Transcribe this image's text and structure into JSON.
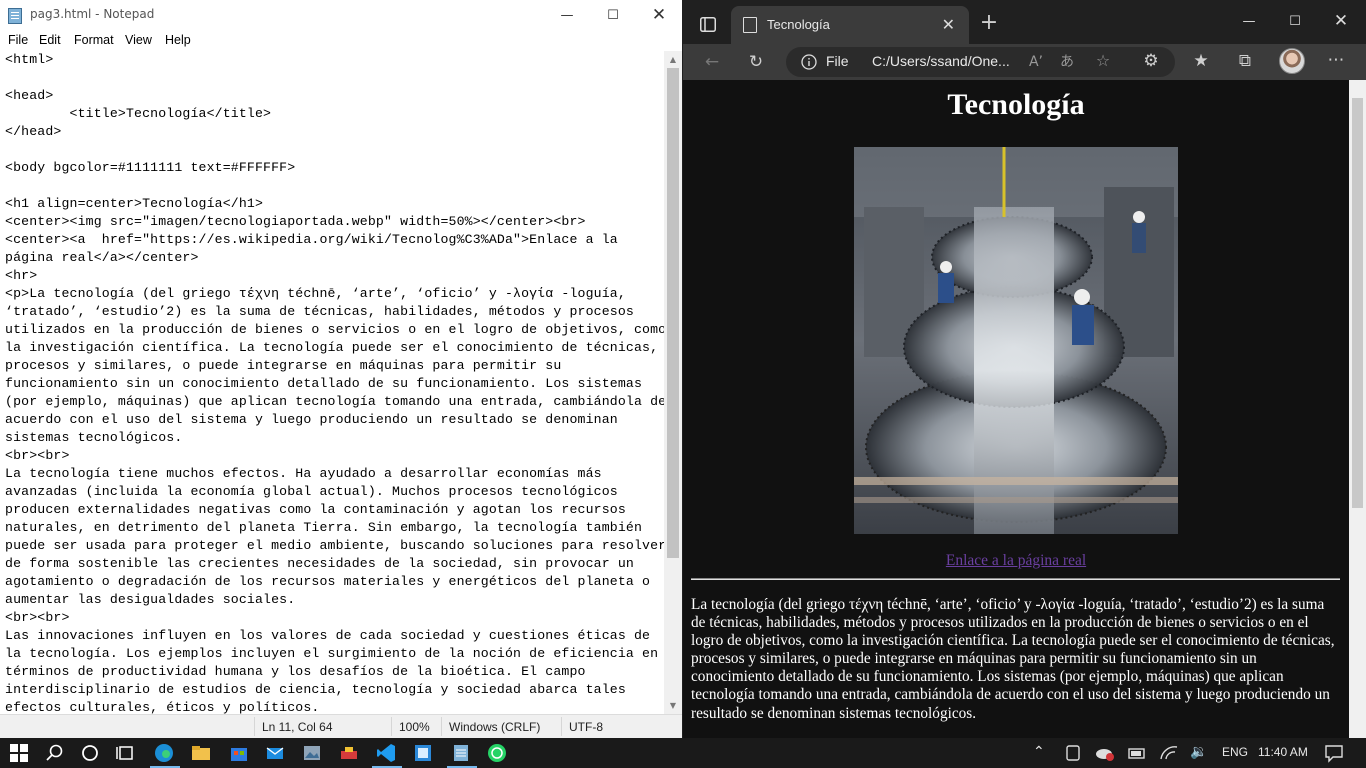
{
  "notepad": {
    "title": "pag3.html - Notepad",
    "menu": [
      "File",
      "Edit",
      "Format",
      "View",
      "Help"
    ],
    "content": "<html>\n\n<head>\n        <title>Tecnología</title>\n</head>\n\n<body bgcolor=#1111111 text=#FFFFFF>\n\n<h1 align=center>Tecnología</h1>\n<center><img src=\"imagen/tecnologiaportada.webp\" width=50%></center><br>\n<center><a  href=\"https://es.wikipedia.org/wiki/Tecnolog%C3%ADa\">Enlace a la\npágina real</a></center>\n<hr>\n<p>La tecnología (del griego τέχνη téchnē, ‘arte’, ‘oficio’ y -λογία -loguía,\n‘tratado’, ‘estudio’2) es la suma de técnicas, habilidades, métodos y procesos\nutilizados en la producción de bienes o servicios o en el logro de objetivos, como\nla investigación científica. La tecnología puede ser el conocimiento de técnicas,\nprocesos y similares, o puede integrarse en máquinas para permitir su\nfuncionamiento sin un conocimiento detallado de su funcionamiento. Los sistemas\n(por ejemplo, máquinas) que aplican tecnología tomando una entrada, cambiándola de\nacuerdo con el uso del sistema y luego produciendo un resultado se denominan\nsistemas tecnológicos.\n<br><br>\nLa tecnología tiene muchos efectos. Ha ayudado a desarrollar economías más\navanzadas (incluida la economía global actual). Muchos procesos tecnológicos\nproducen externalidades negativas como la contaminación y agotan los recursos\nnaturales, en detrimento del planeta Tierra. Sin embargo, la tecnología también\npuede ser usada para proteger el medio ambiente, buscando soluciones para resolver\nde forma sostenible las crecientes necesidades de la sociedad, sin provocar un\nagotamiento o degradación de los recursos materiales y energéticos del planeta o\naumentar las desigualdades sociales.\n<br><br>\nLas innovaciones influyen en los valores de cada sociedad y cuestiones éticas de\nla tecnología. Los ejemplos incluyen el surgimiento de la noción de eficiencia en\ntérminos de productividad humana y los desafíos de la bioética. El campo\ninterdisciplinario de estudios de ciencia, tecnología y sociedad abarca tales\nefectos culturales, éticos y políticos.",
    "status": {
      "position": "Ln 11, Col 64",
      "zoom": "100%",
      "line_ending": "Windows (CRLF)",
      "encoding": "UTF-8"
    }
  },
  "browser": {
    "tab_title": "Tecnología",
    "address_scheme": "File",
    "address": "C:/Users/ssand/One...",
    "page": {
      "heading": "Tecnología",
      "link_text": "Enlace a la página real",
      "paragraph": "La tecnología (del griego τέχνη téchnē, ‘arte’, ‘oficio’ y -λογία -loguía, ‘tratado’, ‘estudio’2) es la suma de técnicas, habilidades, métodos y procesos utilizados en la producción de bienes o servicios o en el logro de objetivos, como la investigación científica. La tecnología puede ser el conocimiento de técnicas, procesos y similares, o puede integrarse en máquinas para permitir su funcionamiento sin un conocimiento detallado de su funcionamiento. Los sistemas (por ejemplo, máquinas) que aplican tecnología tomando una entrada, cambiándola de acuerdo con el uso del sistema y luego produciendo un resultado se denominan sistemas tecnológicos."
    },
    "colors": {
      "page_bg": "#111111",
      "link": "#6a3fa0"
    }
  },
  "taskbar": {
    "language": "ENG",
    "time": "11:40 AM"
  }
}
